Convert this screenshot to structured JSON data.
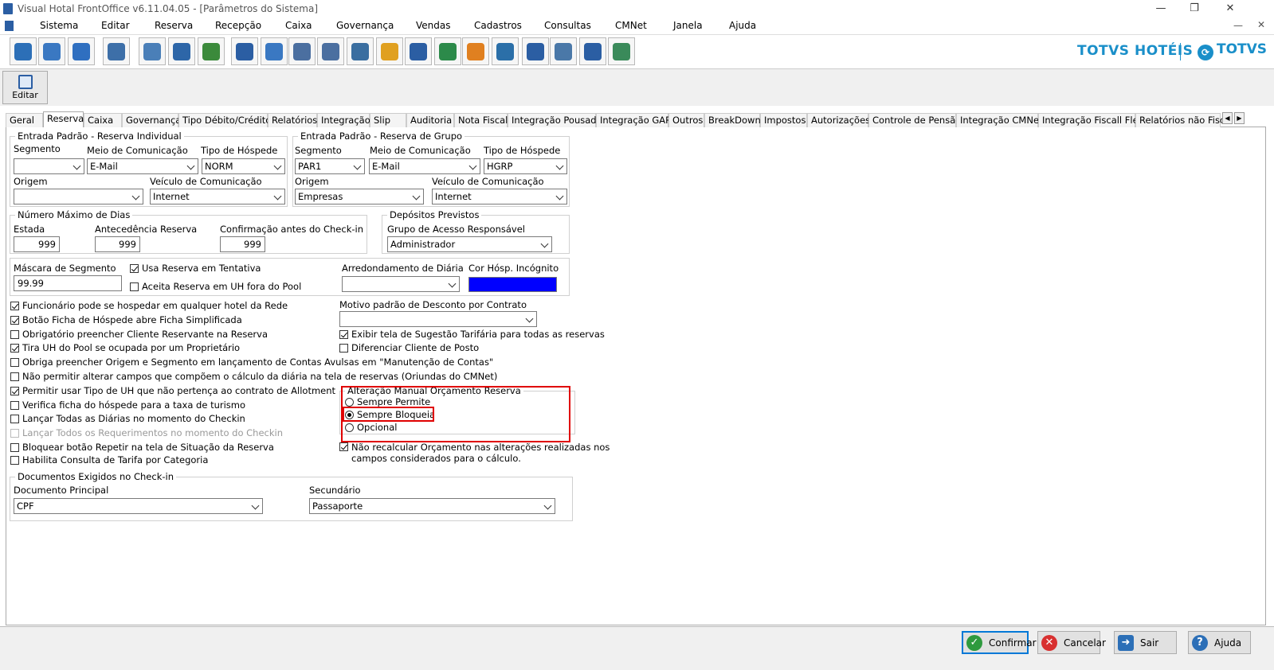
{
  "window": {
    "title": "Visual Hotal FrontOffice v6.11.04.05 - [Parâmetros do Sistema]",
    "minimize": "—",
    "restore": "❐",
    "close": "✕"
  },
  "menu": [
    "Sistema",
    "Editar",
    "Reserva",
    "Recepção",
    "Caixa",
    "Governança",
    "Vendas",
    "Cadastros",
    "Consultas",
    "CMNet",
    "Janela",
    "Ajuda"
  ],
  "brand": {
    "hotels": "TOTVS HOTÉIS",
    "totvs": "TOTVS",
    "logo_glyph": "⟳"
  },
  "toolbar_icons": [
    "exit-icon",
    "user-key-icon",
    "help-icon",
    "org-chart-icon",
    "envelope-icon",
    "grid-edit-icon",
    "send-mail-icon",
    "search-icon",
    "calendar-icon",
    "card-icon",
    "card-list-icon",
    "document-user-icon",
    "bell-icon",
    "footsteps-icon",
    "add-user-icon",
    "users-icon",
    "window-money-icon",
    "cashier-icon",
    "person-icon",
    "email-at-icon",
    "money-icon"
  ],
  "toolbar_colors": [
    "#2c6fb7",
    "#3a78c2",
    "#2f6fc0",
    "#3d6fa8",
    "#4a7fb8",
    "#2d66a8",
    "#3b8a3b",
    "#2b5ea3",
    "#3a78c2",
    "#4b6fa0",
    "#4b6fa0",
    "#3a6ea0",
    "#e0a020",
    "#2b5ea3",
    "#2c8a4a",
    "#e08020",
    "#2b6fa8",
    "#2b5ea3",
    "#4a78a8",
    "#2b5ea3",
    "#3a8a5a"
  ],
  "edit_button": {
    "label": "Editar"
  },
  "tabs": [
    "Geral",
    "Reserva",
    "Caixa",
    "Governança",
    "Tipo Débito/Crédito",
    "Relatórios",
    "Integração",
    "Slip",
    "Auditoria",
    "Nota Fiscal",
    "Integração Pousada",
    "Integração GAP",
    "Outros",
    "BreakDown",
    "Impostos",
    "Autorizações",
    "Controle de Pensão",
    "Integração CMNet",
    "Integração Fiscall Flex",
    "Relatórios não Fisca"
  ],
  "tab_arrows": {
    "left": "◀",
    "right": "▶"
  },
  "individual": {
    "legend": "Entrada Padrão - Reserva Individual",
    "segmento_label": "Segmento",
    "segmento_value": "",
    "meio_label": "Meio de Comunicação",
    "meio_value": "E-Mail",
    "tipo_label": "Tipo de Hóspede",
    "tipo_value": "NORM",
    "origem_label": "Origem",
    "origem_value": "",
    "veiculo_label": "Veículo de Comunicação",
    "veiculo_value": "Internet"
  },
  "grupo": {
    "legend": "Entrada Padrão - Reserva de Grupo",
    "segmento_label": "Segmento",
    "segmento_value": "PAR1",
    "meio_label": "Meio de Comunicação",
    "meio_value": "E-Mail",
    "tipo_label": "Tipo de Hóspede",
    "tipo_value": "HGRP",
    "origem_label": "Origem",
    "origem_value": "Empresas",
    "veiculo_label": "Veículo de Comunicação",
    "veiculo_value": "Internet"
  },
  "max_dias": {
    "legend": "Número Máximo de Dias",
    "estada_label": "Estada",
    "estada_value": "999",
    "antecedencia_label": "Antecedência Reserva",
    "antecedencia_value": "999",
    "confirmacao_label": "Confirmação antes do Check-in",
    "confirmacao_value": "999"
  },
  "depositos": {
    "legend": "Depósitos Previstos",
    "grupo_label": "Grupo de Acesso Responsável",
    "grupo_value": "Administrador"
  },
  "mascara": {
    "label": "Máscara de Segmento",
    "value": "99.99",
    "usa_tentativa": "Usa Reserva em Tentativa",
    "aceita_pool": "Aceita Reserva em UH fora do Pool",
    "arred_label": "Arredondamento de Diária",
    "arred_value": "",
    "cor_label": "Cor Hósp. Incógnito",
    "cor_value": "#0000ff"
  },
  "left_checks": [
    {
      "label": "Funcionário pode se hospedar em qualquer hotel da Rede",
      "checked": true,
      "disabled": false
    },
    {
      "label": "Botão Ficha de Hóspede abre Ficha Simplificada",
      "checked": true,
      "disabled": false
    },
    {
      "label": "Obrigatório preencher Cliente Reservante na Reserva",
      "checked": false,
      "disabled": false
    },
    {
      "label": "Tira UH do Pool se ocupada por um Proprietário",
      "checked": true,
      "disabled": false
    },
    {
      "label": "Obriga preencher Origem e Segmento em lançamento de Contas Avulsas em \"Manutenção de Contas\"",
      "checked": false,
      "disabled": false
    },
    {
      "label": "Não permitir alterar campos que compõem o cálculo da diária na tela de reservas (Oriundas do CMNet)",
      "checked": false,
      "disabled": false
    },
    {
      "label": "Permitir usar Tipo de UH que não pertença ao contrato de Allotment",
      "checked": true,
      "disabled": false
    },
    {
      "label": "Verifica ficha do hóspede para a taxa de turismo",
      "checked": false,
      "disabled": false
    },
    {
      "label": "Lançar Todas as Diárias no momento do Checkin",
      "checked": false,
      "disabled": false
    },
    {
      "label": "Lançar Todos os Requerimentos no momento do Checkin",
      "checked": false,
      "disabled": true
    },
    {
      "label": "Bloquear botão Repetir na tela de Situação da Reserva",
      "checked": false,
      "disabled": false
    },
    {
      "label": "Habilita Consulta de Tarifa por Categoria",
      "checked": false,
      "disabled": false
    }
  ],
  "motivo": {
    "label": "Motivo padrão de Desconto por Contrato",
    "value": ""
  },
  "right_checks": [
    {
      "label": "Exibir tela de Sugestão Tarifária para todas as reservas",
      "checked": true
    },
    {
      "label": "Diferenciar Cliente de Posto",
      "checked": false
    }
  ],
  "orcamento": {
    "legend": "Alteração Manual Orçamento Reserva",
    "options": [
      "Sempre Permite",
      "Sempre Bloqueia",
      "Opcional"
    ],
    "selected_index": 1
  },
  "nao_recalcular": {
    "line1": "Não recalcular Orçamento nas alterações realizadas nos",
    "line2": "campos considerados para o cálculo.",
    "checked": true
  },
  "documentos": {
    "legend": "Documentos Exigidos no Check-in",
    "principal_label": "Documento Principal",
    "principal_value": "CPF",
    "secundario_label": "Secundário",
    "secundario_value": "Passaporte"
  },
  "buttons": {
    "confirmar": "Confirmar",
    "cancelar": "Cancelar",
    "sair": "Sair",
    "ajuda": "Ajuda"
  }
}
